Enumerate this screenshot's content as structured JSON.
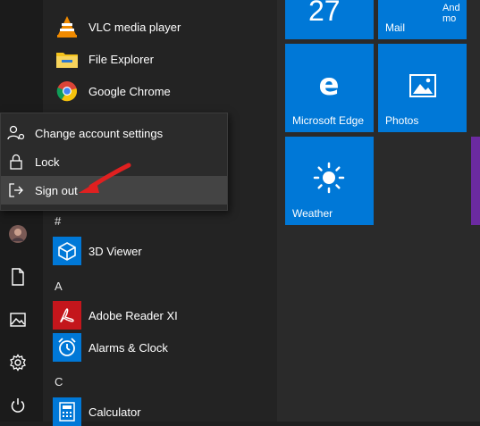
{
  "apps_top": [
    {
      "name": "VLC media player",
      "icon": "vlc-icon"
    },
    {
      "name": "File Explorer",
      "icon": "folder-icon"
    },
    {
      "name": "Google Chrome",
      "icon": "chrome-icon"
    }
  ],
  "sections": [
    {
      "letter": "#",
      "apps": [
        {
          "name": "3D Viewer",
          "icon": "cube-icon"
        }
      ]
    },
    {
      "letter": "A",
      "apps": [
        {
          "name": "Adobe Reader XI",
          "icon": "adobe-icon"
        },
        {
          "name": "Alarms & Clock",
          "icon": "clock-icon"
        }
      ]
    },
    {
      "letter": "C",
      "apps": [
        {
          "name": "Calculator",
          "icon": "calculator-icon"
        }
      ]
    }
  ],
  "account_menu": {
    "change_settings": "Change account settings",
    "lock": "Lock",
    "sign_out": "Sign out"
  },
  "tiles": {
    "calendar_number": "27",
    "mail_label": "Mail",
    "mail_preview": "And mo",
    "edge_label": "Microsoft Edge",
    "photos_label": "Photos",
    "weather_label": "Weather"
  },
  "colors": {
    "tile_blue": "#0078d7",
    "arrow_red": "#e02020",
    "purple_tile": "#6b2aa0"
  }
}
